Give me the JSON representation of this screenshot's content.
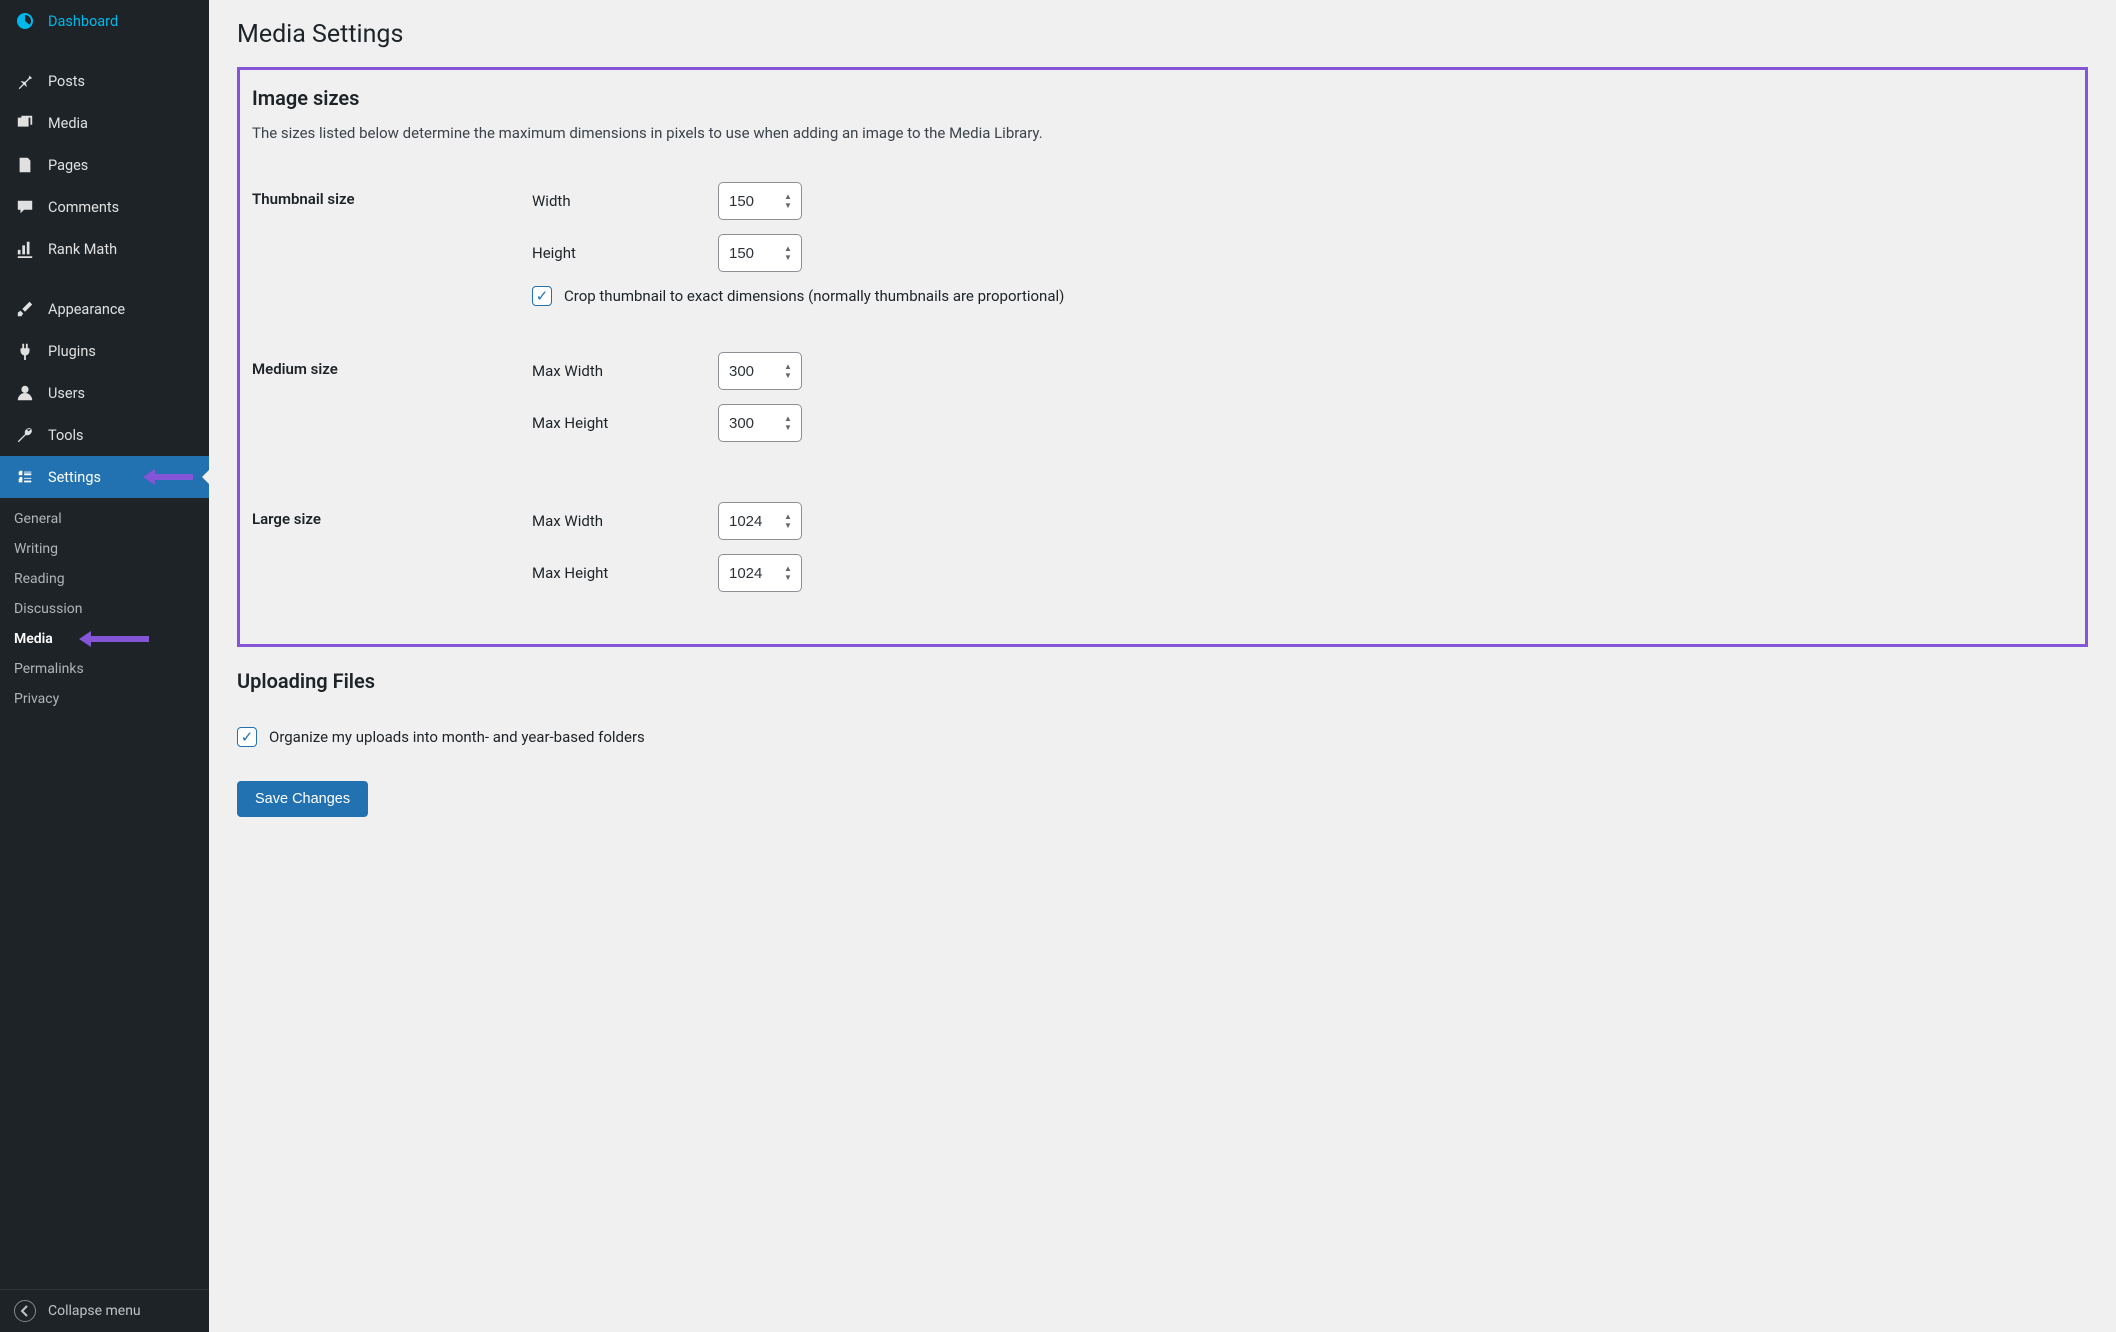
{
  "page": {
    "title": "Media Settings"
  },
  "sidebar": {
    "items": [
      {
        "label": "Dashboard"
      },
      {
        "label": "Posts"
      },
      {
        "label": "Media"
      },
      {
        "label": "Pages"
      },
      {
        "label": "Comments"
      },
      {
        "label": "Rank Math"
      },
      {
        "label": "Appearance"
      },
      {
        "label": "Plugins"
      },
      {
        "label": "Users"
      },
      {
        "label": "Tools"
      },
      {
        "label": "Settings"
      }
    ],
    "submenu": [
      {
        "label": "General"
      },
      {
        "label": "Writing"
      },
      {
        "label": "Reading"
      },
      {
        "label": "Discussion"
      },
      {
        "label": "Media"
      },
      {
        "label": "Permalinks"
      },
      {
        "label": "Privacy"
      }
    ],
    "collapse_label": "Collapse menu"
  },
  "image_sizes": {
    "heading": "Image sizes",
    "description": "The sizes listed below determine the maximum dimensions in pixels to use when adding an image to the Media Library.",
    "thumbnail": {
      "heading": "Thumbnail size",
      "width_label": "Width",
      "width_value": "150",
      "height_label": "Height",
      "height_value": "150",
      "crop_label": "Crop thumbnail to exact dimensions (normally thumbnails are proportional)",
      "crop_checked": true
    },
    "medium": {
      "heading": "Medium size",
      "max_width_label": "Max Width",
      "max_width_value": "300",
      "max_height_label": "Max Height",
      "max_height_value": "300"
    },
    "large": {
      "heading": "Large size",
      "max_width_label": "Max Width",
      "max_width_value": "1024",
      "max_height_label": "Max Height",
      "max_height_value": "1024"
    }
  },
  "uploading": {
    "heading": "Uploading Files",
    "organize_label": "Organize my uploads into month- and year-based folders",
    "organize_checked": true
  },
  "actions": {
    "save_label": "Save Changes"
  },
  "colors": {
    "accent": "#2271b1",
    "highlight": "#8455d6"
  }
}
